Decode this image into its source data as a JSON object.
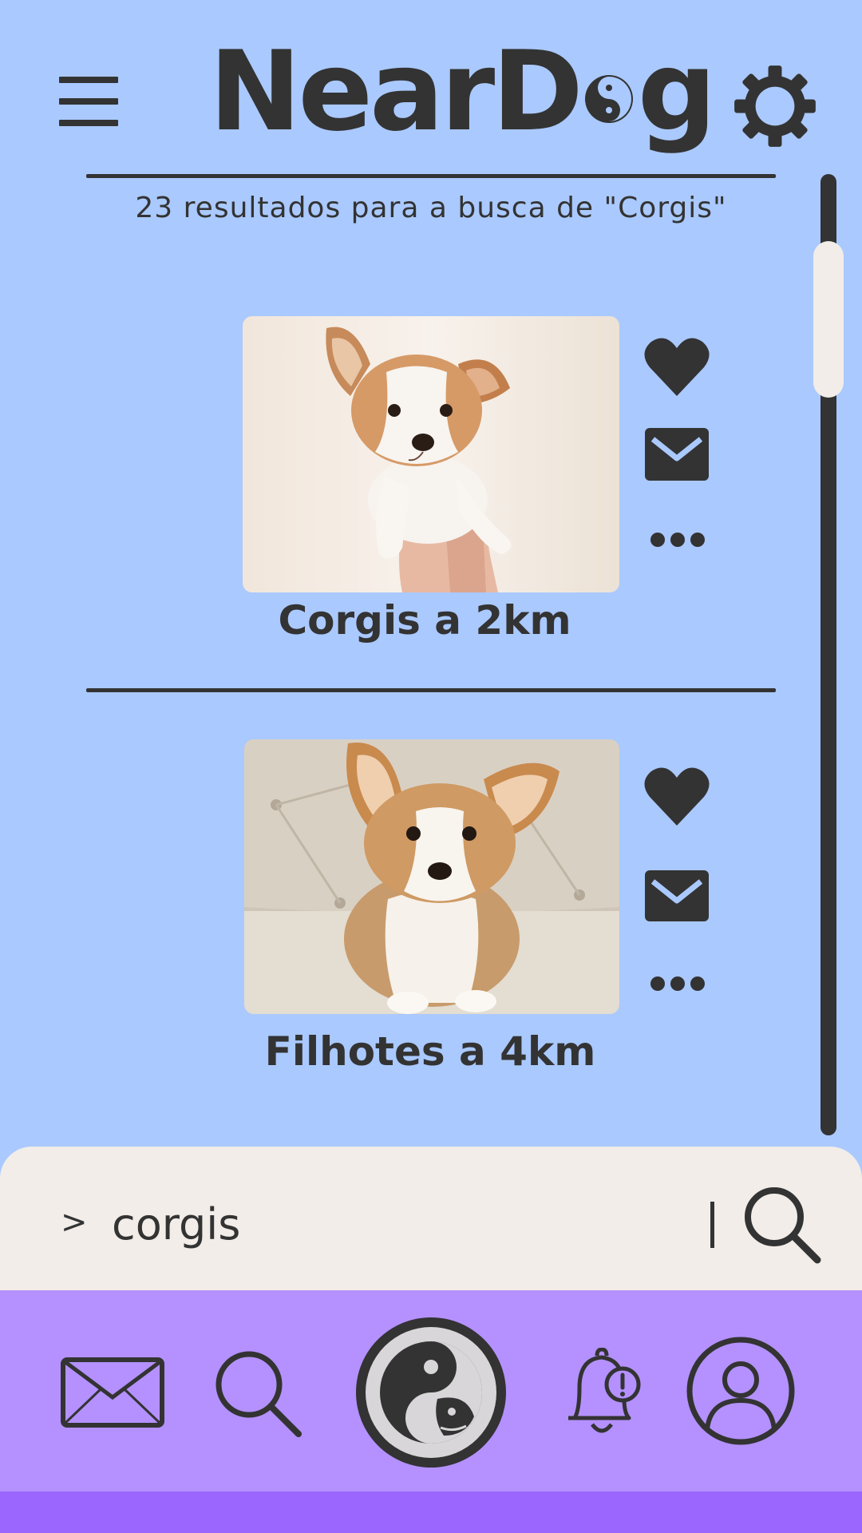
{
  "app": {
    "name": "NearDog",
    "logo_prefix": "NearD",
    "logo_suffix": "g"
  },
  "colors": {
    "background": "#aac9fe",
    "ink": "#333333",
    "panel": "#f2ede8",
    "nav": "#b491fe",
    "nav_strip": "#9a66fd"
  },
  "header": {
    "menu_icon": "hamburger-menu-icon",
    "settings_icon": "gear-icon"
  },
  "results": {
    "summary": "23 resultados para a busca de \"Corgis\""
  },
  "listings": [
    {
      "title": "Corgis a 2km",
      "photo": "corgi puppy held up in hands",
      "actions": [
        "heart-icon",
        "mail-icon",
        "more-dots-icon"
      ]
    },
    {
      "title": "Filhotes a 4km",
      "photo": "corgi puppy sitting on a tufted sofa",
      "actions": [
        "heart-icon",
        "mail-icon",
        "more-dots-icon"
      ]
    }
  ],
  "search": {
    "prompt": ">",
    "value": "corgis",
    "button_icon": "search-icon"
  },
  "bottom_nav": {
    "items": [
      "mail-icon",
      "search-icon",
      "home-yin-yang-dog-icon",
      "bell-alert-icon",
      "profile-icon"
    ]
  }
}
